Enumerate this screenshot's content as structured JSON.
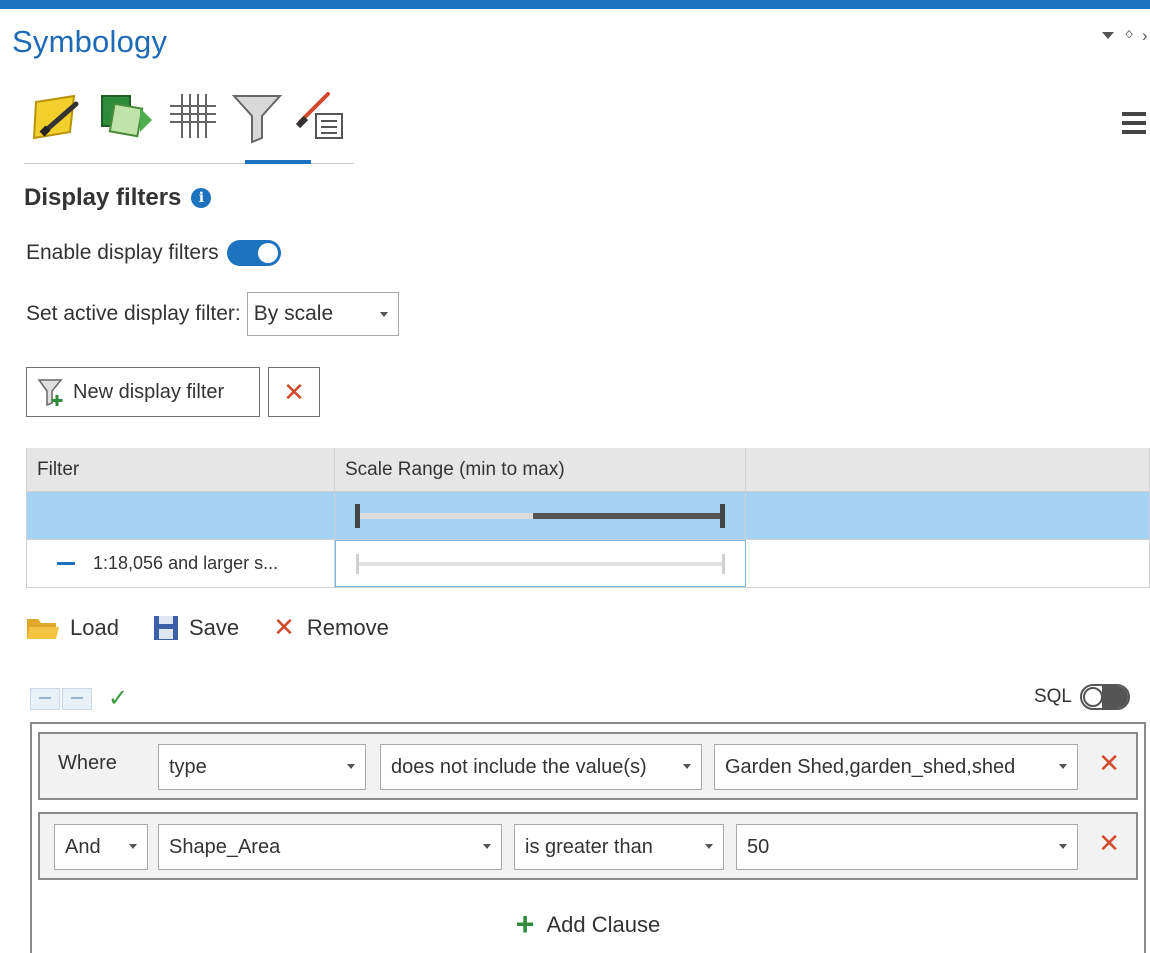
{
  "pane": {
    "title": "Symbology",
    "controls": {
      "menu": "options-menu-icon",
      "pin": "pin-icon",
      "close": "close-icon"
    }
  },
  "tabs": [
    {
      "name": "primary-symbology-tab",
      "icon": "paintbrush-polygon-icon"
    },
    {
      "name": "vary-symbology-tab",
      "icon": "layered-shapes-icon"
    },
    {
      "name": "symbol-layer-drawing-tab",
      "icon": "grid-drawing-icon"
    },
    {
      "name": "display-filters-tab",
      "icon": "funnel-icon",
      "active": true
    },
    {
      "name": "symbol-properties-tab",
      "icon": "brush-list-icon"
    }
  ],
  "heading": "Display filters",
  "enable": {
    "label": "Enable display filters",
    "on": true
  },
  "active_filter": {
    "label": "Set active display filter:",
    "value": "By scale"
  },
  "buttons": {
    "new_filter": "New display filter"
  },
  "grid": {
    "headers": [
      "Filter",
      "Scale Range (min to max)",
      ""
    ],
    "rows": [
      {
        "filter": "",
        "selected": true
      },
      {
        "filter": "1:18,056 and larger s...",
        "selected": false
      }
    ]
  },
  "actions": {
    "load": "Load",
    "save": "Save",
    "remove": "Remove"
  },
  "sql": {
    "label": "SQL",
    "on": false
  },
  "clauses": [
    {
      "connector": "Where",
      "field": "type",
      "operator": "does not include the value(s)",
      "value": "Garden Shed,garden_shed,shed"
    },
    {
      "connector": "And",
      "field": "Shape_Area",
      "operator": "is greater than",
      "value": "50"
    }
  ],
  "add_clause": "Add Clause",
  "colors": {
    "accent": "#1e73be",
    "selected_row": "#a3d2f2",
    "delete": "#d24a2c",
    "add": "#2e8b3a"
  }
}
